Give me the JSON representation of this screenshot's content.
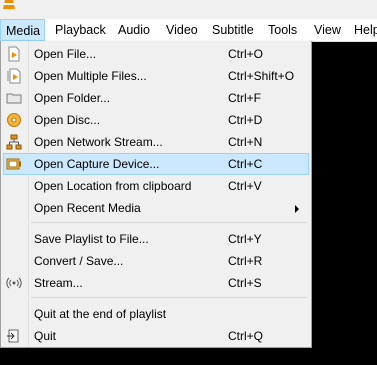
{
  "menubar": {
    "items": [
      "Media",
      "Playback",
      "Audio",
      "Video",
      "Subtitle",
      "Tools",
      "View",
      "Help"
    ]
  },
  "menu": {
    "items": [
      {
        "label": "Open File...",
        "shortcut": "Ctrl+O",
        "icon": "file-icon"
      },
      {
        "label": "Open Multiple Files...",
        "shortcut": "Ctrl+Shift+O",
        "icon": "files-icon"
      },
      {
        "label": "Open Folder...",
        "shortcut": "Ctrl+F",
        "icon": "folder-icon"
      },
      {
        "label": "Open Disc...",
        "shortcut": "Ctrl+D",
        "icon": "disc-icon"
      },
      {
        "label": "Open Network Stream...",
        "shortcut": "Ctrl+N",
        "icon": "network-icon"
      },
      {
        "label": "Open Capture Device...",
        "shortcut": "Ctrl+C",
        "icon": "capture-icon"
      },
      {
        "label": "Open Location from clipboard",
        "shortcut": "Ctrl+V",
        "icon": ""
      },
      {
        "label": "Open Recent Media",
        "shortcut": "",
        "icon": "submenu-arrow-icon"
      },
      {
        "label": "Save Playlist to File...",
        "shortcut": "Ctrl+Y",
        "icon": ""
      },
      {
        "label": "Convert / Save...",
        "shortcut": "Ctrl+R",
        "icon": ""
      },
      {
        "label": "Stream...",
        "shortcut": "Ctrl+S",
        "icon": "stream-icon"
      },
      {
        "label": "Quit at the end of playlist",
        "shortcut": "",
        "icon": ""
      },
      {
        "label": "Quit",
        "shortcut": "Ctrl+Q",
        "icon": "exit-icon"
      }
    ]
  },
  "colors": {
    "highlight": "#cce8ff",
    "highlight_border": "#99d1ff",
    "menu_bg": "#f0f0f0",
    "cone_orange": "#f28c00"
  }
}
